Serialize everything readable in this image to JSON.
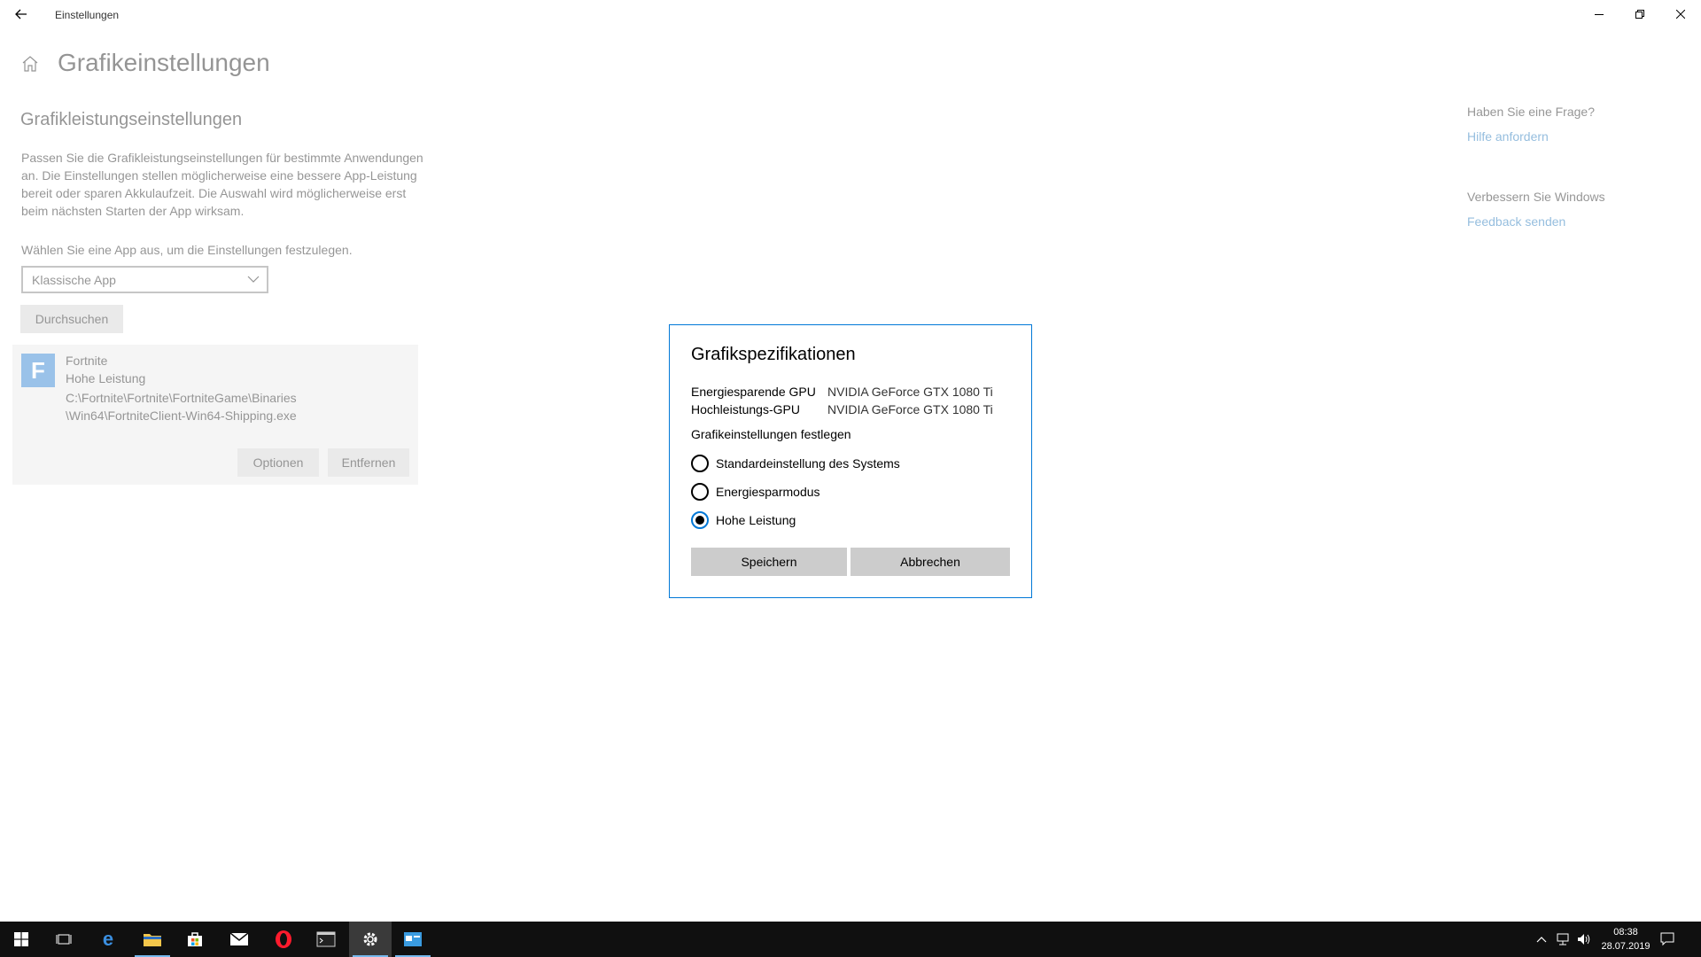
{
  "window": {
    "title": "Einstellungen"
  },
  "page": {
    "title": "Grafikeinstellungen",
    "section_title": "Grafikleistungseinstellungen",
    "description": "Passen Sie die Grafikleistungseinstellungen für bestimmte Anwendungen an. Die Einstellungen stellen möglicherweise eine bessere App-Leistung bereit oder sparen Akkulaufzeit. Die Auswahl wird möglicherweise erst beim nächsten Starten der App wirksam.",
    "choose_label": "Wählen Sie eine App aus, um die Einstellungen festzulegen.",
    "app_type_selected": "Klassische App",
    "browse_label": "Durchsuchen",
    "app": {
      "icon_letter": "F",
      "name": "Fortnite",
      "mode": "Hohe Leistung",
      "path_line1": "C:\\Fortnite\\Fortnite\\FortniteGame\\Binaries",
      "path_line2": "\\Win64\\FortniteClient-Win64-Shipping.exe",
      "options_label": "Optionen",
      "remove_label": "Entfernen"
    }
  },
  "side": {
    "help_question": "Haben Sie eine Frage?",
    "help_link": "Hilfe anfordern",
    "improve": "Verbessern Sie Windows",
    "feedback_link": "Feedback senden"
  },
  "dialog": {
    "title": "Grafikspezifikationen",
    "power_saving_gpu_label": "Energiesparende GPU",
    "power_saving_gpu_value": "NVIDIA GeForce GTX 1080 Ti",
    "high_perf_gpu_label": "Hochleistungs-GPU",
    "high_perf_gpu_value": "NVIDIA GeForce GTX 1080 Ti",
    "settings_label": "Grafikeinstellungen festlegen",
    "options": [
      {
        "label": "Standardeinstellung des Systems",
        "checked": false
      },
      {
        "label": "Energiesparmodus",
        "checked": false
      },
      {
        "label": "Hohe Leistung",
        "checked": true
      }
    ],
    "save_label": "Speichern",
    "cancel_label": "Abbrechen"
  },
  "taskbar": {
    "time": "08:38",
    "date": "28.07.2019"
  },
  "colors": {
    "accent": "#0078d7",
    "link": "#0063b1",
    "button_gray": "#cccccc",
    "taskbar": "#101010"
  }
}
